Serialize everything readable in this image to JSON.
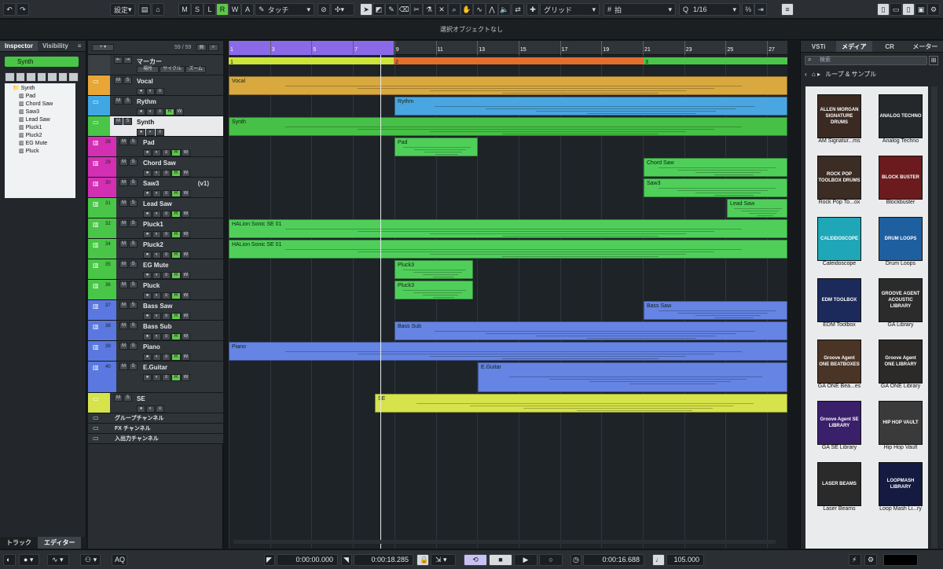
{
  "toolbar": {
    "settings": "設定",
    "automation_mode": "タッチ",
    "snap_type": "グリッド",
    "grid_type": "拍",
    "quantize": "1/16",
    "mode_buttons": [
      "M",
      "S",
      "L",
      "R",
      "W",
      "A"
    ]
  },
  "status": {
    "message": "選択オブジェクトなし"
  },
  "inspector": {
    "tabs": [
      "Inspector",
      "Visibility"
    ],
    "track_name": "Synth",
    "tree": [
      "Synth",
      "Pad",
      "Chord Saw",
      "Saw3",
      "Lead Saw",
      "Pluck1",
      "Pluck2",
      "EG Mute",
      "Pluck"
    ]
  },
  "tracklist": {
    "count": "59 / 59",
    "marker": {
      "name": "マーカー",
      "tabs": [
        "場所",
        "サイクル",
        "ズーム"
      ]
    },
    "tracks": [
      {
        "name": "Vocal"
      },
      {
        "name": "Rythm"
      },
      {
        "name": "Synth"
      },
      {
        "name": "Pad",
        "num": "28"
      },
      {
        "name": "Chord Saw",
        "num": "29"
      },
      {
        "name": "Saw3",
        "num": "30",
        "ver": "(v1)"
      },
      {
        "name": "Lead Saw",
        "num": "31"
      },
      {
        "name": "Pluck1",
        "num": "32"
      },
      {
        "name": "Pluck2",
        "num": "34"
      },
      {
        "name": "EG Mute",
        "num": "35"
      },
      {
        "name": "Pluck",
        "num": "36"
      },
      {
        "name": "Bass Saw",
        "num": "37"
      },
      {
        "name": "Bass Sub",
        "num": "38"
      },
      {
        "name": "Piano",
        "num": "39"
      },
      {
        "name": "E.Guitar",
        "num": "40"
      },
      {
        "name": "SE"
      },
      {
        "name": "グループチャンネル"
      },
      {
        "name": "FX チャンネル"
      },
      {
        "name": "入出力チャンネル"
      }
    ]
  },
  "ruler": {
    "bars": [
      "1",
      "3",
      "5",
      "7",
      "9",
      "11",
      "13",
      "15",
      "17",
      "19",
      "21",
      "23",
      "25",
      "27"
    ]
  },
  "markers": [
    "1",
    "2",
    "3"
  ],
  "events": {
    "vocal": "Vocal",
    "rythm": "Rythm",
    "synth": "Synth",
    "pad": "Pad",
    "chord_saw": "Chord Saw",
    "saw3": "Saw3",
    "lead_saw": "Lead Saw",
    "pluck1": "HALion Sonic SE 01",
    "pluck2": "HALion Sonic SE 01",
    "pluck3a": "Pluck3",
    "pluck3b": "Pluck3",
    "bass_saw": "Bass Saw",
    "bass_sub": "Bass Sub",
    "piano": "Piano",
    "eguitar": "E.Guitar",
    "se": "SE"
  },
  "media": {
    "tabs": [
      "VSTi",
      "メディア",
      "CR",
      "メーター"
    ],
    "search_placeholder": "検索",
    "breadcrumb": "ループ & サンプル",
    "tiles": [
      {
        "label": "AM Signatur...ms",
        "art": "ALLEN MORGAN SIGNATURE DRUMS",
        "color": "#3a2a22"
      },
      {
        "label": "Analog Techno",
        "art": "ANALOG TECHNO",
        "color": "#25282b"
      },
      {
        "label": "Rock Pop To...ox",
        "art": "ROCK POP TOOLBOX DRUMS",
        "color": "#3b2c24"
      },
      {
        "label": "Blockbuster",
        "art": "BLOCK BUSTER",
        "color": "#6b1b1d"
      },
      {
        "label": "Caleidoscope",
        "art": "CALEIDOSCOPE",
        "color": "#1fa7b7"
      },
      {
        "label": "Drum Loops",
        "art": "DRUM LOOPS",
        "color": "#1e5fa0"
      },
      {
        "label": "EDM Toolbox",
        "art": "EDM TOOLBOX",
        "color": "#1b2a5a"
      },
      {
        "label": "GA Library",
        "art": "GROOVE AGENT ACOUSTIC LIBRARY",
        "color": "#2b2b2b"
      },
      {
        "label": "GA ONE Bea...es",
        "art": "Groove Agent ONE BEATBOXES",
        "color": "#4a3426"
      },
      {
        "label": "GA ONE Library",
        "art": "Groove Agent ONE LIBRARY",
        "color": "#2c2a28"
      },
      {
        "label": "GA SE Library",
        "art": "Groove Agent SE LIBRARY",
        "color": "#3a1f6a"
      },
      {
        "label": "Hip Hop Vault",
        "art": "HIP HOP VAULT",
        "color": "#3a3a3a"
      },
      {
        "label": "Laser Beams",
        "art": "LASER BEAMS",
        "color": "#2a2a2a"
      },
      {
        "label": "Loop Mash Li...ry",
        "art": "LOOPMASH LIBRARY",
        "color": "#151a40"
      }
    ]
  },
  "transport": {
    "left_locator": "0:00:00.000",
    "right_locator": "0:00:18.285",
    "position": "0:00:16.688",
    "tempo": "105.000",
    "aq": "AQ"
  },
  "bottom_tabs": [
    "トラック",
    "エディター"
  ]
}
